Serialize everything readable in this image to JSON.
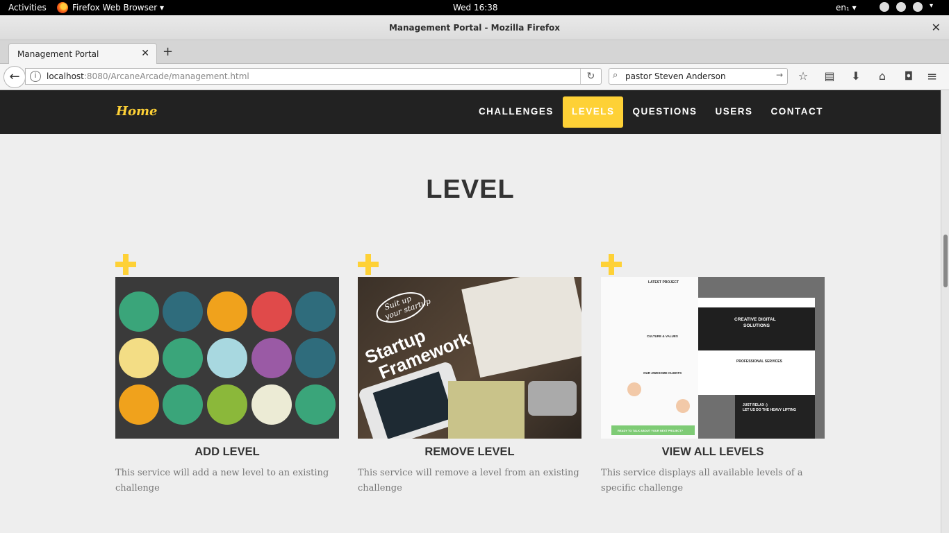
{
  "os": {
    "activities": "Activities",
    "app_name": "Firefox Web Browser ▾",
    "clock": "Wed 16:38",
    "lang": "en₁ ▾"
  },
  "window": {
    "title": "Management Portal - Mozilla Firefox",
    "close": "✕"
  },
  "tabs": [
    {
      "label": "Management Portal",
      "close": "✕"
    }
  ],
  "newtab": "+",
  "navbar": {
    "url_host": "localhost",
    "url_port_path": ":8080/ArcaneArcade/management.html",
    "search_value": "pastor Steven Anderson"
  },
  "site": {
    "brand": "Home",
    "nav": [
      "CHALLENGES",
      "LEVELS",
      "QUESTIONS",
      "USERS",
      "CONTACT"
    ],
    "active_nav": "LEVELS",
    "accent": "#fed136",
    "section_title": "LEVEL",
    "cards": [
      {
        "title": "ADD LEVEL",
        "desc": "This service will add a new level to an existing challenge"
      },
      {
        "title": "REMOVE LEVEL",
        "desc": "This service will remove a level from an existing challenge"
      },
      {
        "title": "VIEW ALL LEVELS",
        "desc": "This service displays all available levels of a specific challenge"
      }
    ],
    "thumb2_text": [
      "Suit up",
      "your startup",
      "Startup",
      "Framework"
    ],
    "thumb3_text": [
      "LATEST PROJECT",
      "CREATIVE DIGITAL",
      "SOLUTIONS",
      "CULTURE & VALUES",
      "PROFESSIONAL SERVICES",
      "OUR AWESOME CLIENTS",
      "JUST RELAX :)",
      "LET US DO THE HEAVY LIFTING",
      "READY TO TALK ABOUT YOUR NEXT PROJECT?"
    ]
  }
}
